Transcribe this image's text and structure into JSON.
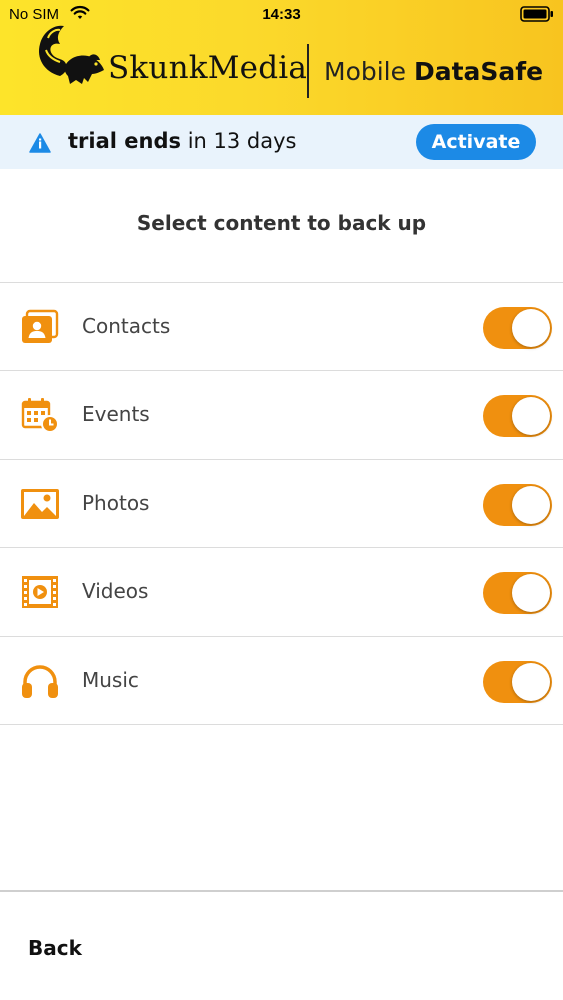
{
  "status_bar": {
    "carrier": "No SIM",
    "time": "14:33"
  },
  "header": {
    "brand": "SkunkMedia",
    "product_prefix": "Mobile",
    "product_bold": "DataSafe",
    "colors": {
      "gradient_start": "#fde42a",
      "gradient_end": "#f8c41f"
    }
  },
  "trial": {
    "text_bold": "trial ends",
    "text_rest": "in 13 days",
    "activate_label": "Activate",
    "icon": "info-icon",
    "colors": {
      "background": "#e9f3fc",
      "accent": "#1c8ae6"
    }
  },
  "main": {
    "title": "Select content to back up",
    "items": [
      {
        "label": "Contacts",
        "icon": "contacts-icon",
        "enabled": true
      },
      {
        "label": "Events",
        "icon": "calendar-icon",
        "enabled": true
      },
      {
        "label": "Photos",
        "icon": "photo-icon",
        "enabled": true
      },
      {
        "label": "Videos",
        "icon": "video-icon",
        "enabled": true
      },
      {
        "label": "Music",
        "icon": "headphones-icon",
        "enabled": true
      }
    ],
    "colors": {
      "toggle_on": "#f0900f",
      "icon": "#f0900f"
    }
  },
  "footer": {
    "back_label": "Back"
  }
}
